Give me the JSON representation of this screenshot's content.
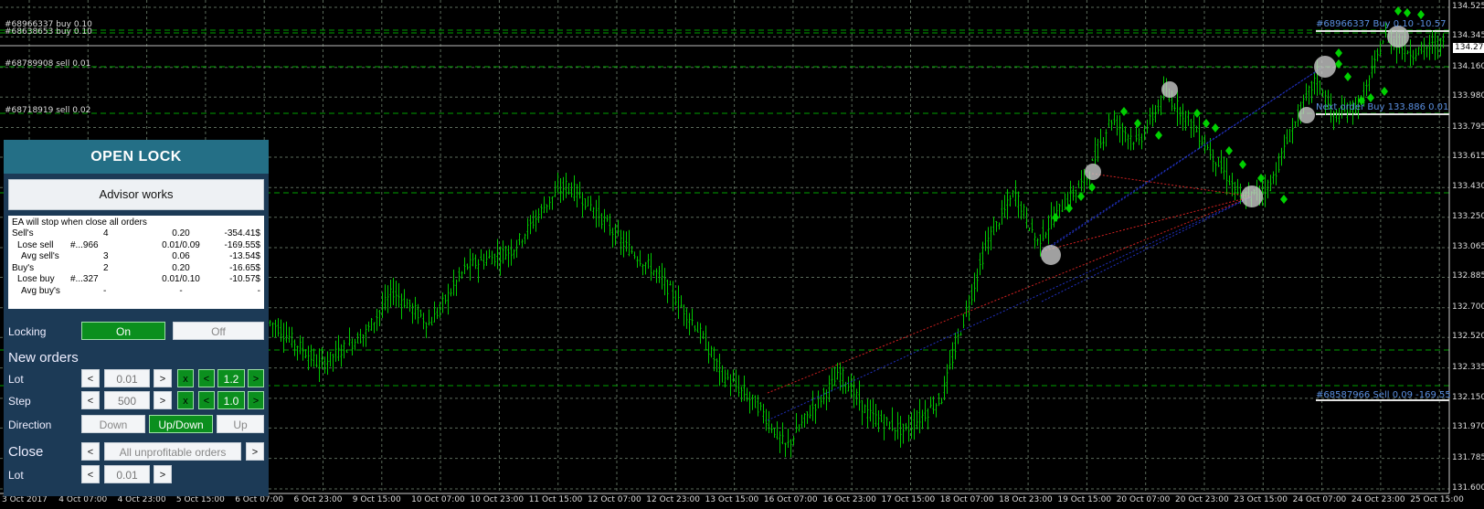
{
  "order_labels": [
    {
      "text": "#68966337 buy 0.10"
    },
    {
      "text": "#68638653 buy 0.10"
    },
    {
      "text": "#68789908 sell 0.01"
    },
    {
      "text": "#68718919 sell 0.02"
    }
  ],
  "price_axis": [
    "134.525",
    "134.345",
    "134.160",
    "133.980",
    "133.795",
    "133.615",
    "133.430",
    "133.250",
    "133.065",
    "132.885",
    "132.700",
    "132.520",
    "132.335",
    "132.150",
    "131.970",
    "131.785",
    "131.600"
  ],
  "current_price": "134.277",
  "time_axis": [
    "3 Oct 2017",
    "4 Oct 07:00",
    "4 Oct 23:00",
    "5 Oct 15:00",
    "6 Oct 07:00",
    "6 Oct 23:00",
    "9 Oct 15:00",
    "10 Oct 07:00",
    "10 Oct 23:00",
    "11 Oct 15:00",
    "12 Oct 07:00",
    "12 Oct 23:00",
    "13 Oct 15:00",
    "16 Oct 07:00",
    "16 Oct 23:00",
    "17 Oct 15:00",
    "18 Oct 07:00",
    "18 Oct 23:00",
    "19 Oct 15:00",
    "20 Oct 07:00",
    "20 Oct 23:00",
    "23 Oct 15:00",
    "24 Oct 07:00",
    "24 Oct 23:00",
    "25 Oct 15:00"
  ],
  "right_labels": {
    "buy_line": "#68966337 Buy 0.10 -10.57",
    "next_order": "Next order Buy 133.886 0.01",
    "sell_line": "#68587966 Sell 0.09 -169.55"
  },
  "panel": {
    "title": "OPEN LOCK",
    "status": "Advisor works",
    "info_title": "EA will stop when close all orders",
    "info_rows": [
      {
        "c1": "Sell's",
        "c2": "",
        "c3": "4",
        "c3b": "0.20",
        "c4": "-354.41$"
      },
      {
        "c1": "Lose sell",
        "c2": "#...966",
        "c3": "",
        "c3b": "0.01/0.09",
        "c4": "-169.55$"
      },
      {
        "c1": "Avg sell's",
        "c2": "",
        "c3": "3",
        "c3b": "0.06",
        "c4": "-13.54$"
      },
      {
        "c1": "Buy's",
        "c2": "",
        "c3": "2",
        "c3b": "0.20",
        "c4": "-16.65$"
      },
      {
        "c1": "Lose buy",
        "c2": "#...327",
        "c3": "",
        "c3b": "0.01/0.10",
        "c4": "-10.57$"
      },
      {
        "c1": "Avg buy's",
        "c2": "",
        "c3": "-",
        "c3b": "-",
        "c4": "-"
      }
    ],
    "locking_label": "Locking",
    "locking_on": "On",
    "locking_off": "Off",
    "new_orders_label": "New orders",
    "lot_label": "Lot",
    "lot_value": "0.01",
    "lot_mult": "1.2",
    "step_label": "Step",
    "step_value": "500",
    "step_mult": "1.0",
    "direction_label": "Direction",
    "dir_down": "Down",
    "dir_updown": "Up/Down",
    "dir_up": "Up",
    "close_label": "Close",
    "close_select": "All unprofitable orders",
    "close_lot_label": "Lot",
    "close_lot_value": "0.01",
    "prev": "<",
    "next": ">",
    "x": "x"
  },
  "colors": {
    "candle": "#00c800",
    "grid": "#5a6a5a",
    "panel_bg": "#1c3a56",
    "header_bg": "#246f86",
    "on_green": "#0b8f1e"
  }
}
